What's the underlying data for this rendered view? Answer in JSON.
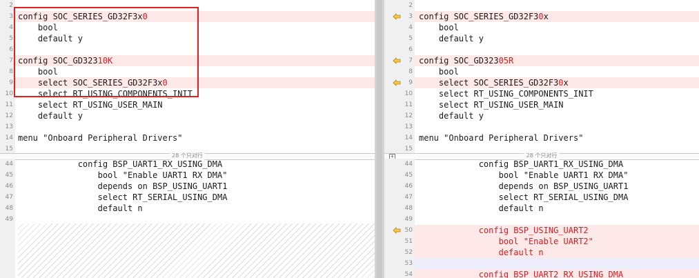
{
  "separator": {
    "collapsed_text": "28 个只对行"
  },
  "left_top_lines": [
    {
      "num": "2",
      "segs": []
    },
    {
      "num": "3",
      "diff": true,
      "segs": [
        {
          "t": "config SOC_SERIES_GD32F3x"
        },
        {
          "t": "0",
          "red": true
        }
      ]
    },
    {
      "num": "4",
      "segs": [
        {
          "t": "    bool"
        }
      ]
    },
    {
      "num": "5",
      "segs": [
        {
          "t": "    default y"
        }
      ]
    },
    {
      "num": "6",
      "segs": []
    },
    {
      "num": "7",
      "diff": true,
      "segs": [
        {
          "t": "config SOC_GD323"
        },
        {
          "t": "10K",
          "red": true
        }
      ]
    },
    {
      "num": "8",
      "segs": [
        {
          "t": "    bool"
        }
      ]
    },
    {
      "num": "9",
      "diff": true,
      "segs": [
        {
          "t": "    select SOC_SERIES_GD32F3x"
        },
        {
          "t": "0",
          "red": true
        }
      ]
    },
    {
      "num": "10",
      "segs": [
        {
          "t": "    select RT_USING_COMPONENTS_INIT"
        }
      ]
    },
    {
      "num": "11",
      "segs": [
        {
          "t": "    select RT_USING_USER_MAIN"
        }
      ]
    },
    {
      "num": "12",
      "segs": [
        {
          "t": "    default y"
        }
      ]
    },
    {
      "num": "13",
      "segs": []
    },
    {
      "num": "14",
      "segs": [
        {
          "t": "menu \"Onboard Peripheral Drivers\""
        }
      ]
    },
    {
      "num": "15",
      "segs": []
    }
  ],
  "left_bottom_lines": [
    {
      "num": "44",
      "segs": [
        {
          "t": "            config BSP_UART1_RX_USING_DMA"
        }
      ]
    },
    {
      "num": "45",
      "segs": [
        {
          "t": "                bool \"Enable UART1 RX DMA\""
        }
      ]
    },
    {
      "num": "46",
      "segs": [
        {
          "t": "                depends on BSP_USING_UART1"
        }
      ]
    },
    {
      "num": "47",
      "segs": [
        {
          "t": "                select RT_SERIAL_USING_DMA"
        }
      ]
    },
    {
      "num": "48",
      "segs": [
        {
          "t": "                default n"
        }
      ]
    },
    {
      "num": "49",
      "segs": []
    }
  ],
  "right_top_lines": [
    {
      "num": "2",
      "segs": []
    },
    {
      "num": "3",
      "diff": true,
      "arrow": true,
      "segs": [
        {
          "t": "config SOC_SERIES_GD32F3"
        },
        {
          "t": "0",
          "red": true
        },
        {
          "t": "x"
        }
      ]
    },
    {
      "num": "4",
      "segs": [
        {
          "t": "    bool"
        }
      ]
    },
    {
      "num": "5",
      "segs": [
        {
          "t": "    default y"
        }
      ]
    },
    {
      "num": "6",
      "segs": []
    },
    {
      "num": "7",
      "diff": true,
      "arrow": true,
      "segs": [
        {
          "t": "config SOC_GD323"
        },
        {
          "t": "05R",
          "red": true
        }
      ]
    },
    {
      "num": "8",
      "segs": [
        {
          "t": "    bool"
        }
      ]
    },
    {
      "num": "9",
      "diff": true,
      "arrow": true,
      "segs": [
        {
          "t": "    select SOC_SERIES_GD32F3"
        },
        {
          "t": "0",
          "red": true
        },
        {
          "t": "x"
        }
      ]
    },
    {
      "num": "10",
      "segs": [
        {
          "t": "    select RT_USING_COMPONENTS_INIT"
        }
      ]
    },
    {
      "num": "11",
      "segs": [
        {
          "t": "    select RT_USING_USER_MAIN"
        }
      ]
    },
    {
      "num": "12",
      "segs": [
        {
          "t": "    default y"
        }
      ]
    },
    {
      "num": "13",
      "segs": []
    },
    {
      "num": "14",
      "segs": [
        {
          "t": "menu \"Onboard Peripheral Drivers\""
        }
      ]
    },
    {
      "num": "15",
      "segs": []
    }
  ],
  "right_bottom_lines": [
    {
      "num": "44",
      "segs": [
        {
          "t": "            config BSP_UART1_RX_USING_DMA"
        }
      ]
    },
    {
      "num": "45",
      "segs": [
        {
          "t": "                bool \"Enable UART1 RX DMA\""
        }
      ]
    },
    {
      "num": "46",
      "segs": [
        {
          "t": "                depends on BSP_USING_UART1"
        }
      ]
    },
    {
      "num": "47",
      "segs": [
        {
          "t": "                select RT_SERIAL_USING_DMA"
        }
      ]
    },
    {
      "num": "48",
      "segs": [
        {
          "t": "                default n"
        }
      ]
    },
    {
      "num": "49",
      "segs": []
    },
    {
      "num": "50",
      "diff": true,
      "arrow": true,
      "segs": [
        {
          "t": "            config BSP_USING_UART2",
          "red": true
        }
      ]
    },
    {
      "num": "51",
      "diff": true,
      "segs": [
        {
          "t": "                bool \"Enable UART2\"",
          "red": true
        }
      ]
    },
    {
      "num": "52",
      "diff": true,
      "segs": [
        {
          "t": "                default n",
          "red": true
        }
      ]
    },
    {
      "num": "53",
      "blank": true,
      "segs": []
    },
    {
      "num": "54",
      "diff": true,
      "segs": [
        {
          "t": "            config BSP_UART2_RX_USING_DMA",
          "red": true
        }
      ]
    }
  ],
  "colors": {
    "diff_bg": "#ffe8e8",
    "changed_text": "#e0191f",
    "highlight_box": "#e02020",
    "arrow_marker": "#f2c94c"
  }
}
